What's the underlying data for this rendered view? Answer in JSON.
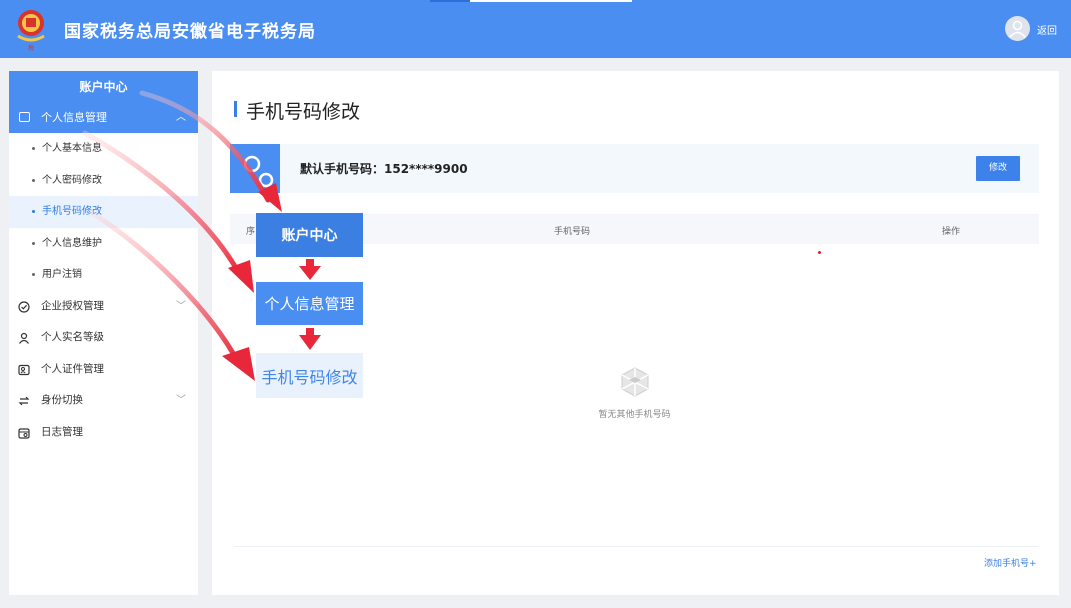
{
  "header": {
    "title": "国家税务总局安徽省电子税务局",
    "back_label": "返回",
    "brand_color": "#4a8ef1"
  },
  "sidebar": {
    "head": "账户中心",
    "group": {
      "label": "个人信息管理",
      "expanded": true
    },
    "sub_items": [
      {
        "label": "个人基本信息",
        "active": false
      },
      {
        "label": "个人密码修改",
        "active": false
      },
      {
        "label": "手机号码修改",
        "active": true
      },
      {
        "label": "个人信息维护",
        "active": false
      },
      {
        "label": "用户注销",
        "active": false
      }
    ],
    "items": [
      {
        "label": "企业授权管理",
        "icon": "badge-check-icon",
        "has_chevron": true
      },
      {
        "label": "个人实名等级",
        "icon": "user-icon",
        "has_chevron": false
      },
      {
        "label": "个人证件管理",
        "icon": "id-card-icon",
        "has_chevron": false
      },
      {
        "label": "身份切换",
        "icon": "switch-icon",
        "has_chevron": true
      },
      {
        "label": "日志管理",
        "icon": "calendar-log-icon",
        "has_chevron": false
      }
    ]
  },
  "main": {
    "page_title": "手机号码修改",
    "default_phone_label": "默认手机号码：152****9900",
    "edit_button": "修改",
    "table_headers": [
      "序",
      "手机号码",
      "操作"
    ],
    "empty_text": "暂无其他手机号码",
    "add_link": "添加手机号+"
  },
  "annotation": {
    "steps": [
      "账户中心",
      "个人信息管理",
      "手机号码修改"
    ],
    "arrow_color": "#e8283a"
  }
}
